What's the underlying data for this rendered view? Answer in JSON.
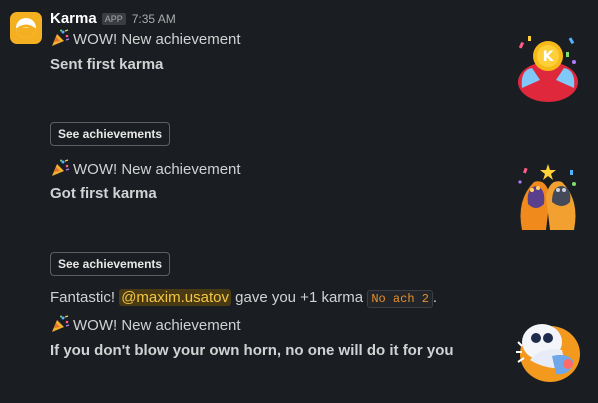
{
  "message": {
    "sender": "Karma",
    "app_badge": "APP",
    "timestamp": "7:35 AM"
  },
  "blocks": [
    {
      "emoji": "party-popper-icon",
      "headline": "WOW! New achievement",
      "title": "Sent first karma",
      "button_label": "See achievements",
      "image": "karma-coin-hands-illustration"
    },
    {
      "emoji": "party-popper-icon",
      "headline": "WOW! New achievement",
      "title": "Got first karma",
      "button_label": "See achievements",
      "image": "high-five-illustration"
    }
  ],
  "karma_message": {
    "prefix": "Fantastic!",
    "mention": "@maxim.usatov",
    "middle": "gave you +1 karma",
    "code": "No ach 2",
    "suffix": "."
  },
  "block3": {
    "emoji": "party-popper-icon",
    "headline": "WOW! New achievement",
    "title": "If you don't blow your own horn, no one will do it for you",
    "image": "horn-blowing-illustration"
  },
  "colors": {
    "background": "#1a1d21",
    "app_icon": "#f4b021",
    "mention_text": "#f2c744",
    "code_text": "#e8912d"
  }
}
